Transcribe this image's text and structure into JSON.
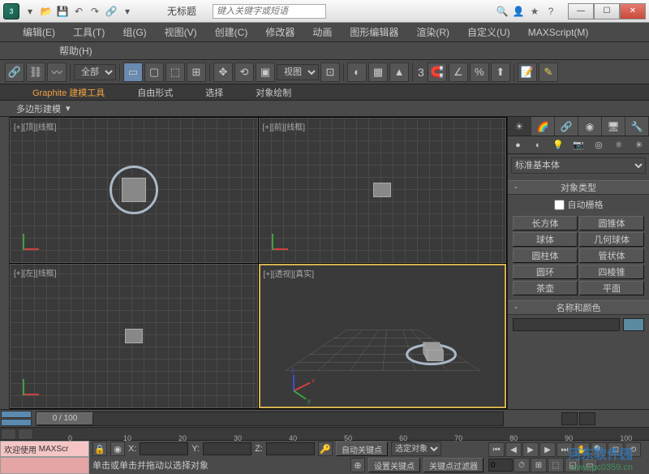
{
  "title": "无标题",
  "search_placeholder": "键入关键字或短语",
  "menus": [
    "编辑(E)",
    "工具(T)",
    "组(G)",
    "视图(V)",
    "创建(C)",
    "修改器",
    "动画",
    "图形编辑器",
    "渲染(R)",
    "自定义(U)",
    "MAXScript(M)"
  ],
  "menus2": [
    "帮助(H)"
  ],
  "toolbar": {
    "all_label": "全部",
    "view_label": "视图",
    "angle": "3"
  },
  "ribbon": {
    "tabs": [
      "Graphite 建模工具",
      "自由形式",
      "选择",
      "对象绘制"
    ],
    "panel": "多边形建模"
  },
  "viewports": [
    {
      "label": "[+][顶][线框]"
    },
    {
      "label": "[+][前][线框]"
    },
    {
      "label": "[+][左][线框]"
    },
    {
      "label": "[+][透视][真实]"
    }
  ],
  "command_panel": {
    "dropdown": "标准基本体",
    "rollout1": "对象类型",
    "autogrid": "自动栅格",
    "primitives": [
      [
        "长方体",
        "圆锥体"
      ],
      [
        "球体",
        "几何球体"
      ],
      [
        "圆柱体",
        "管状体"
      ],
      [
        "圆环",
        "四棱锥"
      ],
      [
        "茶壶",
        "平面"
      ]
    ],
    "rollout2": "名称和颜色"
  },
  "timeline": {
    "handle": "0 / 100",
    "ticks": [
      "0",
      "10",
      "20",
      "30",
      "40",
      "50",
      "60",
      "70",
      "80",
      "90",
      "100"
    ]
  },
  "status": {
    "welcome": "欢迎使用",
    "script": "MAXScr",
    "prompt": "单击或单击并拖动以选择对象",
    "coords": {
      "x": "X:",
      "y": "Y:",
      "z": "Z:"
    },
    "auto_key": "自动关键点",
    "set_key": "设置关键点",
    "selected": "选定对象",
    "key_filter": "关键点过滤器"
  },
  "watermark": "河东软件园",
  "watermark_url": "www.pc0359.cn"
}
